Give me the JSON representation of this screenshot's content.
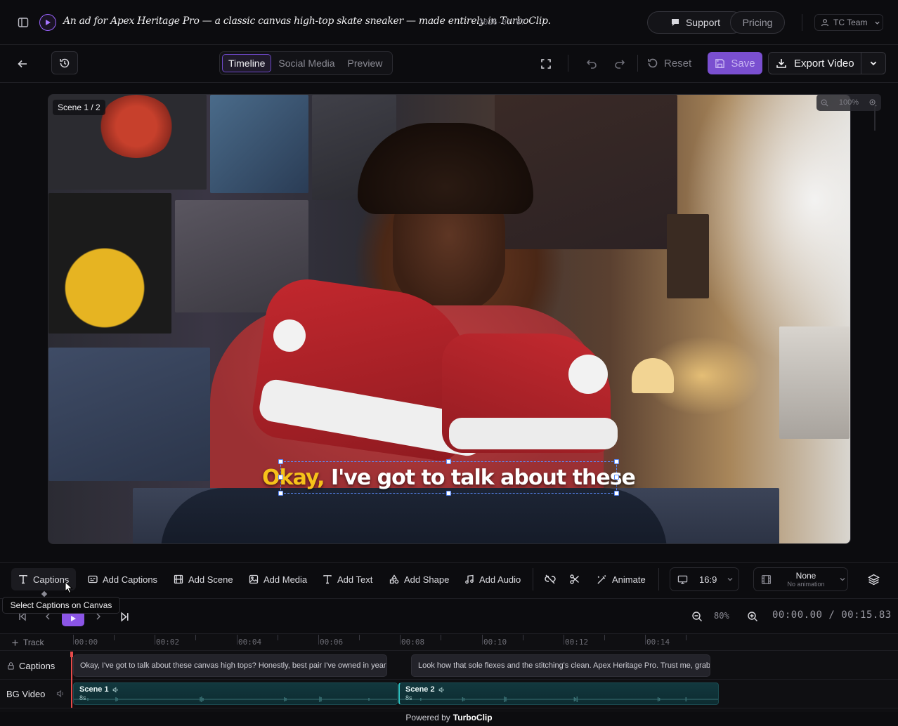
{
  "header": {
    "project_title": "An ad for Apex Heritage Pro — a classic canvas high-top skate sneaker — made entirely in TurboClip.",
    "date_sep": "·",
    "date": "2026-07-07",
    "support_label": "Support",
    "pricing_label": "Pricing",
    "team_label": "TC Team"
  },
  "toolbar": {
    "tabs": [
      "Timeline",
      "Social Media",
      "Preview"
    ],
    "active_tab": "Timeline",
    "reset_label": "Reset",
    "save_label": "Save",
    "export_label": "Export Video"
  },
  "canvas": {
    "scene_badge": "Scene 1 / 2",
    "zoom_level": "100%",
    "caption_highlight": "Okay,",
    "caption_rest": " I've got to talk about these"
  },
  "tools": {
    "captions": "Captions",
    "add_captions": "Add Captions",
    "add_scene": "Add Scene",
    "add_media": "Add Media",
    "add_text": "Add Text",
    "add_shape": "Add Shape",
    "add_audio": "Add Audio",
    "animate": "Animate",
    "aspect_ratio": "16:9",
    "animation_title": "None",
    "animation_sub": "No animation",
    "tooltip": "Select Captions on Canvas"
  },
  "transport": {
    "zoom_pct": "80%",
    "current_time": "00:00.00",
    "time_sep": "/",
    "total_time": "00:15.83"
  },
  "timeline": {
    "add_track": "Track",
    "ruler": [
      "00:00",
      "00:02",
      "00:04",
      "00:06",
      "00:08",
      "00:10",
      "00:12",
      "00:14"
    ],
    "captions_track": "Captions",
    "video_track": "BG Video",
    "caption_clips": [
      "Okay, I've got to talk about these canvas high tops? Honestly, best pair I've owned in years",
      "Look how that sole flexes and the stitching's clean. Apex Heritage Pro. Trust me, grab a pair"
    ],
    "video_clips": [
      {
        "name": "Scene 1",
        "duration": "8s"
      },
      {
        "name": "Scene 2",
        "duration": "8s"
      }
    ]
  },
  "footer": {
    "powered_by": "Powered by",
    "brand": "TurboClip"
  },
  "colors": {
    "accent": "#8b55e6",
    "caption_highlight": "#f6c21a",
    "selection": "#5b8cff",
    "playhead": "#e64b4b",
    "video_clip": "#12383e"
  },
  "icons": [
    "sidebar-toggle-icon",
    "brand-play-icon",
    "chat-icon",
    "users-icon",
    "chevron-down-icon",
    "arrow-left-icon",
    "history-icon",
    "fullscreen-icon",
    "undo-icon",
    "redo-icon",
    "reset-icon",
    "save-icon",
    "download-icon",
    "text-icon",
    "captions-icon",
    "film-icon",
    "image-icon",
    "shapes-icon",
    "music-icon",
    "unlink-icon",
    "scissors-icon",
    "wand-icon",
    "monitor-icon",
    "layers-icon",
    "skip-back-icon",
    "play-icon",
    "skip-forward-icon",
    "zoom-out-icon",
    "zoom-in-icon",
    "plus-icon",
    "lock-icon",
    "volume-icon"
  ]
}
